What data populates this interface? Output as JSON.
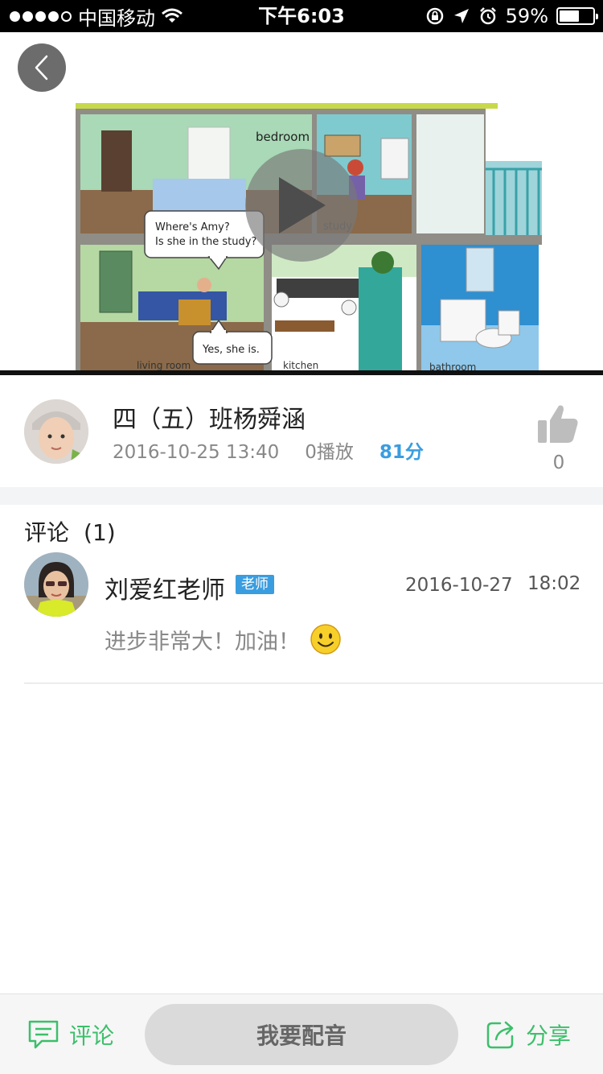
{
  "status_bar": {
    "carrier": "中国移动",
    "time": "下午6:03",
    "battery_percent": "59%"
  },
  "video": {
    "labels": {
      "bedroom": "bedroom",
      "study": "study",
      "living_room": "living room",
      "kitchen": "kitchen",
      "bathroom": "bathroom"
    },
    "bubble_question_line1": "Where's Amy?",
    "bubble_question_line2": "Is she in the study?",
    "bubble_answer": "Yes, she is."
  },
  "author": {
    "name": "四（五）班杨舜涵",
    "datetime": "2016-10-25 13:40",
    "plays": "0播放",
    "score": "81分",
    "likes": "0"
  },
  "comments": {
    "title": "评论",
    "count": "(1)",
    "items": [
      {
        "author": "刘爱红老师",
        "badge": "老师",
        "date": "2016-10-27",
        "time": "18:02",
        "text": "进步非常大！加油！"
      }
    ]
  },
  "bottom_bar": {
    "comment_label": "评论",
    "dub_label": "我要配音",
    "share_label": "分享"
  },
  "colors": {
    "accent_blue": "#3a9de0",
    "accent_green": "#3cbf6b"
  }
}
